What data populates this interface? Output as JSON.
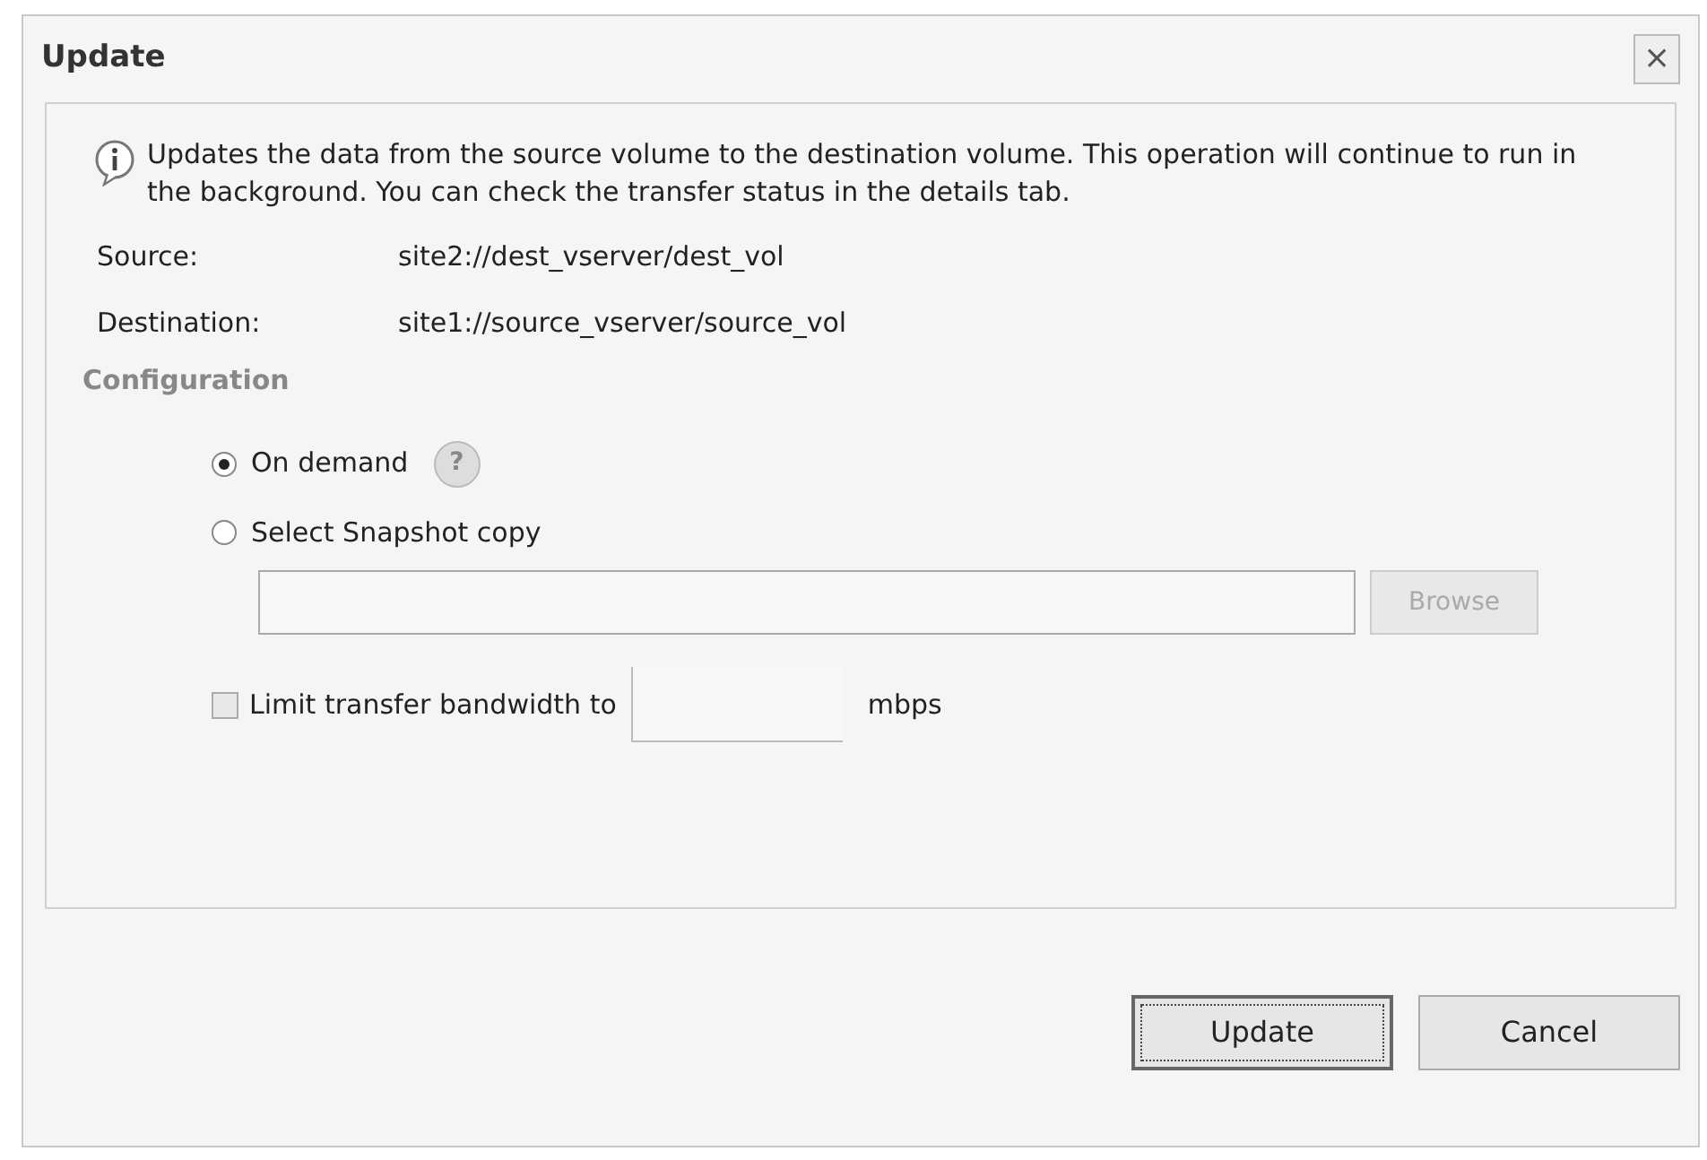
{
  "window": {
    "title": "Update",
    "close": "×"
  },
  "description": "Updates the data from the source volume to the destination volume. This operation will continue to run in the background. You can check the transfer status in the details tab.",
  "details": [
    {
      "label": "Source:",
      "value": "site2://dest_vserver/dest_vol"
    },
    {
      "label": "Destination:",
      "value": "site1://source_vserver/source_vol"
    }
  ],
  "section_title": "Configuration",
  "options": [
    {
      "label": "On demand",
      "selected": true,
      "help": "?"
    },
    {
      "label": "Select Snapshot copy",
      "selected": false
    }
  ],
  "snapshot": {
    "browse": "Browse",
    "disabled": true
  },
  "limit": {
    "label": "Limit transfer bandwidth to",
    "checked": false,
    "unit": "mbps"
  },
  "buttons": [
    {
      "label": "Update",
      "focused": true
    },
    {
      "label": "Cancel",
      "focused": false
    }
  ]
}
